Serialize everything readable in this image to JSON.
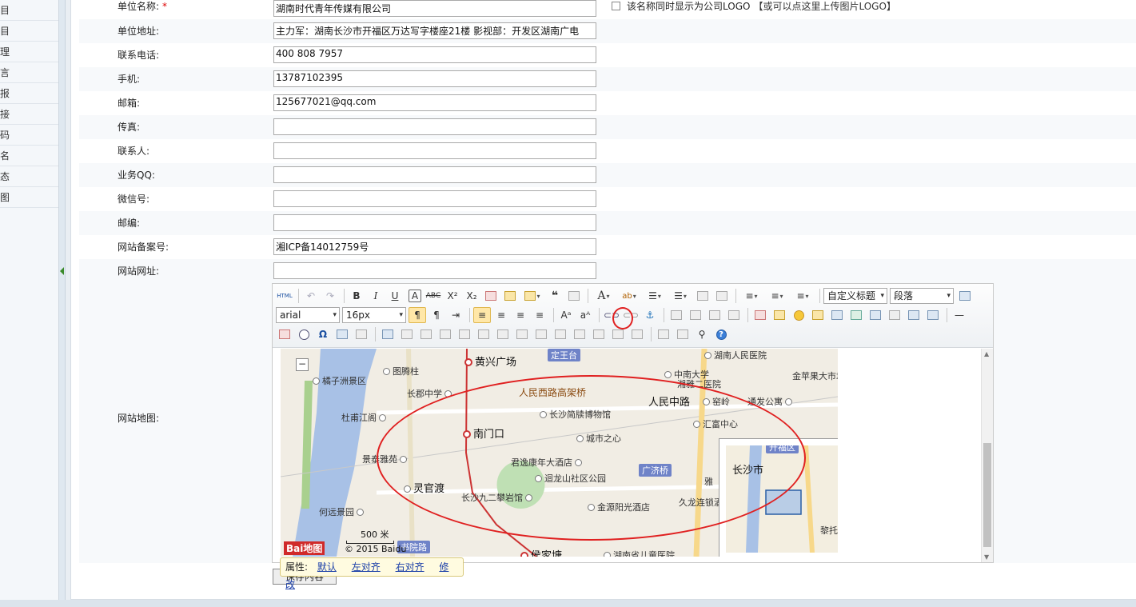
{
  "sidebar": {
    "items": [
      "目",
      "目",
      "理",
      "言",
      "报",
      "接",
      "码",
      "名",
      "态",
      "图"
    ]
  },
  "form": {
    "company_name": {
      "label": "单位名称:",
      "required_mark": "*",
      "value": "湖南时代青年传媒有限公司"
    },
    "logo_option": {
      "label": "该名称同时显示为公司LOGO",
      "upload_link": "【或可以点这里上传图片LOGO】"
    },
    "address": {
      "label": "单位地址:",
      "value": "主力军：湖南长沙市开福区万达写字楼座21楼 影视部：开发区湖南广电"
    },
    "phone": {
      "label": "联系电话:",
      "value": "400 808 7957"
    },
    "mobile": {
      "label": "手机:",
      "value": "13787102395"
    },
    "email": {
      "label": "邮箱:",
      "value": "125677021@qq.com"
    },
    "fax": {
      "label": "传真:",
      "value": ""
    },
    "contact": {
      "label": "联系人:",
      "value": ""
    },
    "qq": {
      "label": "业务QQ:",
      "value": ""
    },
    "wechat": {
      "label": "微信号:",
      "value": ""
    },
    "zipcode": {
      "label": "邮编:",
      "value": ""
    },
    "icp": {
      "label": "网站备案号:",
      "value": "湘ICP备14012759号"
    },
    "website": {
      "label": "网站网址:",
      "value": ""
    },
    "map": {
      "label": "网站地图:"
    }
  },
  "editor": {
    "font_family": "arial",
    "font_size": "16px",
    "heading_select": "自定义标题",
    "paragraph_select": "段落",
    "html_button": "HTML"
  },
  "map": {
    "labels": {
      "huangxing": "黄兴广场",
      "dingwangtai": "定王台",
      "hunan_people_hospital": "湖南人民医院",
      "juzizhou": "橘子洲景区",
      "tutengzhen": "图腾柱",
      "zhongnan": "中南大学",
      "xiangya2": "湘雅二医院",
      "jinguo": "金苹果大市场",
      "changjun": "长郡中学",
      "renminxilu": "人民西路高架桥",
      "renminzhonglu": "人民中路",
      "zhaling": "窑岭",
      "tongda": "通发公寓",
      "dujiang": "杜甫江阁",
      "jiandu": "长沙简牍博物馆",
      "huifu": "汇富中心",
      "nanmenkou": "南门口",
      "chengshi": "城市之心",
      "jingfu": "景泰雅苑",
      "junyi": "君逸康年大酒店",
      "guangji": "广济桥",
      "lingguandu": "灵官渡",
      "huilong": "迴龙山社区公园",
      "jiuer": "长沙九二攀岩馆",
      "jinyuan": "金源阳光酒店",
      "jiulong": "久龙连锁酒",
      "hejing": "何远景园",
      "yuan_lu": "书院路",
      "houjiatang": "侯家塘",
      "children_hospital": "湖南省儿童医院",
      "ya": "雅",
      "li": "黎托",
      "changsha_city": "长沙市",
      "kaifu": "开福区"
    },
    "scale": "500 米",
    "copyright": "© 2015 Baidu",
    "brand": "Bai地图",
    "zoom_out": "−"
  },
  "image_props": {
    "label": "属性:",
    "actions": [
      "默认",
      "左对齐",
      "右对齐",
      "修改"
    ]
  },
  "save_button": "保存内容"
}
